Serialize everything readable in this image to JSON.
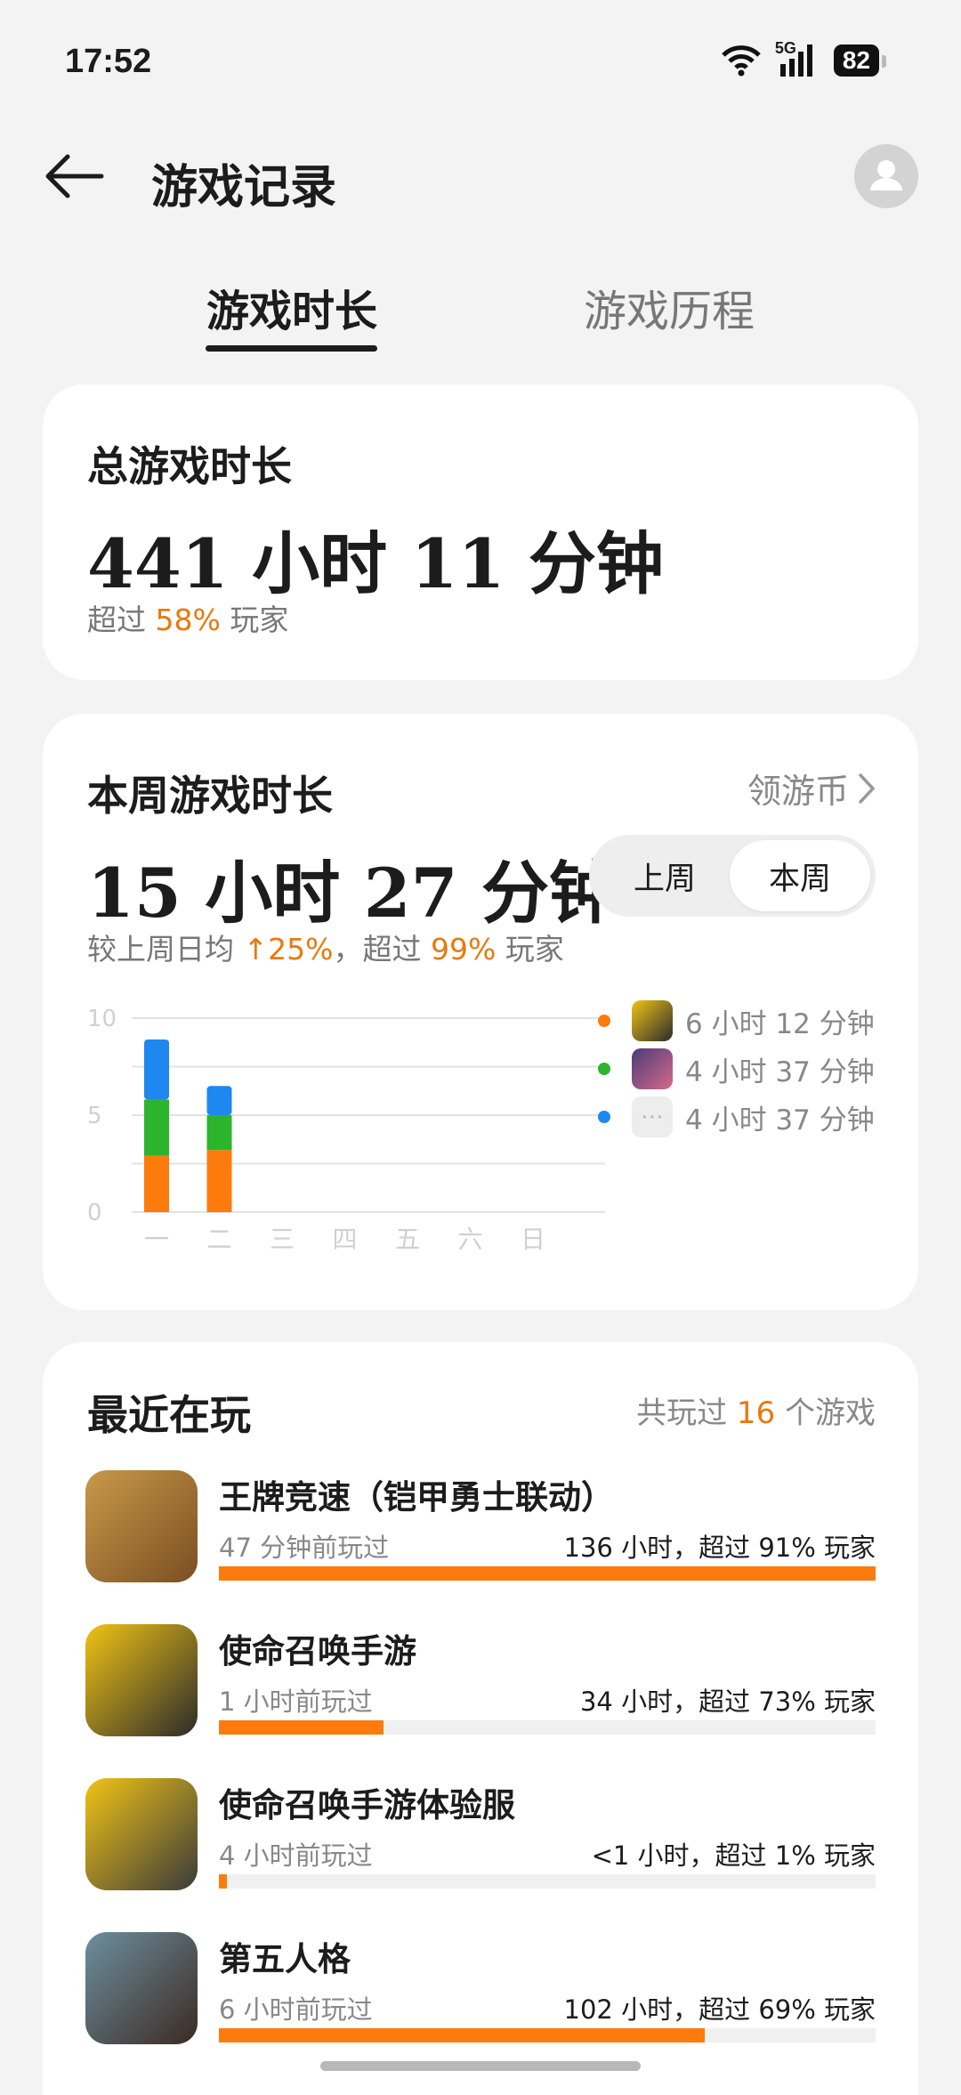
{
  "status_bar": {
    "time": "17:52",
    "network": "5G",
    "battery": "82"
  },
  "header": {
    "title": "游戏记录"
  },
  "tabs": [
    {
      "label": "游戏时长",
      "active": true
    },
    {
      "label": "游戏历程",
      "active": false
    }
  ],
  "total_card": {
    "label": "总游戏时长",
    "hours": "441",
    "hours_unit": "小时",
    "minutes": "11",
    "minutes_unit": "分钟",
    "exceed_prefix": "超过",
    "exceed_percent": "58%",
    "exceed_suffix": "玩家"
  },
  "weekly_card": {
    "label": "本周游戏时长",
    "claim_link": "领游币",
    "hours": "15",
    "hours_unit": "小时",
    "minutes": "27",
    "minutes_unit": "分钟",
    "toggle": {
      "prev": "上周",
      "current": "本周",
      "selected": "本周"
    },
    "compare_prefix": "较上周日均",
    "compare_arrow": "↑",
    "compare_percent": "25%",
    "compare_mid": "，超过",
    "exceed_percent": "99%",
    "exceed_suffix": "玩家"
  },
  "chart_data": {
    "type": "bar",
    "stacked": true,
    "categories": [
      "一",
      "二",
      "三",
      "四",
      "五",
      "六",
      "日"
    ],
    "yticks": [
      0,
      5,
      10
    ],
    "ylim": [
      0,
      10
    ],
    "grid": true,
    "series": [
      {
        "values": [
          2.9,
          3.2,
          0,
          0,
          0,
          0,
          0
        ],
        "color": "#fc7b0c"
      },
      {
        "values": [
          2.9,
          1.8,
          0,
          0,
          0,
          0,
          0
        ],
        "color": "#2cb52c"
      },
      {
        "values": [
          3.1,
          1.5,
          0,
          0,
          0,
          0,
          0
        ],
        "color": "#1e87f0"
      }
    ],
    "legend": [
      {
        "color": "#fc7b0c",
        "icon": "call-of-duty-game-icon",
        "text": "6 小时 12 分钟"
      },
      {
        "color": "#2cb52c",
        "icon": "identity-v-game-icon",
        "text": "4 小时 37 分钟"
      },
      {
        "color": "#1e87f0",
        "icon": "more-games-icon",
        "text": "4 小时 37 分钟"
      }
    ]
  },
  "recent_card": {
    "label": "最近在玩",
    "played_prefix": "共玩过",
    "played_count": "16",
    "played_suffix": "个游戏",
    "games": [
      {
        "name": "王牌竞速（铠甲勇士联动）",
        "last_played": "47 分钟前玩过",
        "stat": "136 小时，超过 91% 玩家",
        "progress": 1.0,
        "icon": "ace-racer-game-icon",
        "colors": [
          "#c89a4a",
          "#7a4e22"
        ]
      },
      {
        "name": "使命召唤手游",
        "last_played": "1 小时前玩过",
        "stat": "34 小时，超过 73% 玩家",
        "progress": 0.25,
        "icon": "call-of-duty-game-icon",
        "colors": [
          "#f1c315",
          "#2b2b2b"
        ]
      },
      {
        "name": "使命召唤手游体验服",
        "last_played": "4 小时前玩过",
        "stat": "<1 小时，超过 1% 玩家",
        "progress": 0.01,
        "icon": "call-of-duty-test-game-icon",
        "colors": [
          "#f1c315",
          "#3a3a3a"
        ]
      },
      {
        "name": "第五人格",
        "last_played": "6 小时前玩过",
        "stat": "102 小时，超过 69% 玩家",
        "progress": 0.74,
        "icon": "identity-v-game-icon",
        "colors": [
          "#6d8fa0",
          "#3b2a22"
        ]
      }
    ]
  }
}
